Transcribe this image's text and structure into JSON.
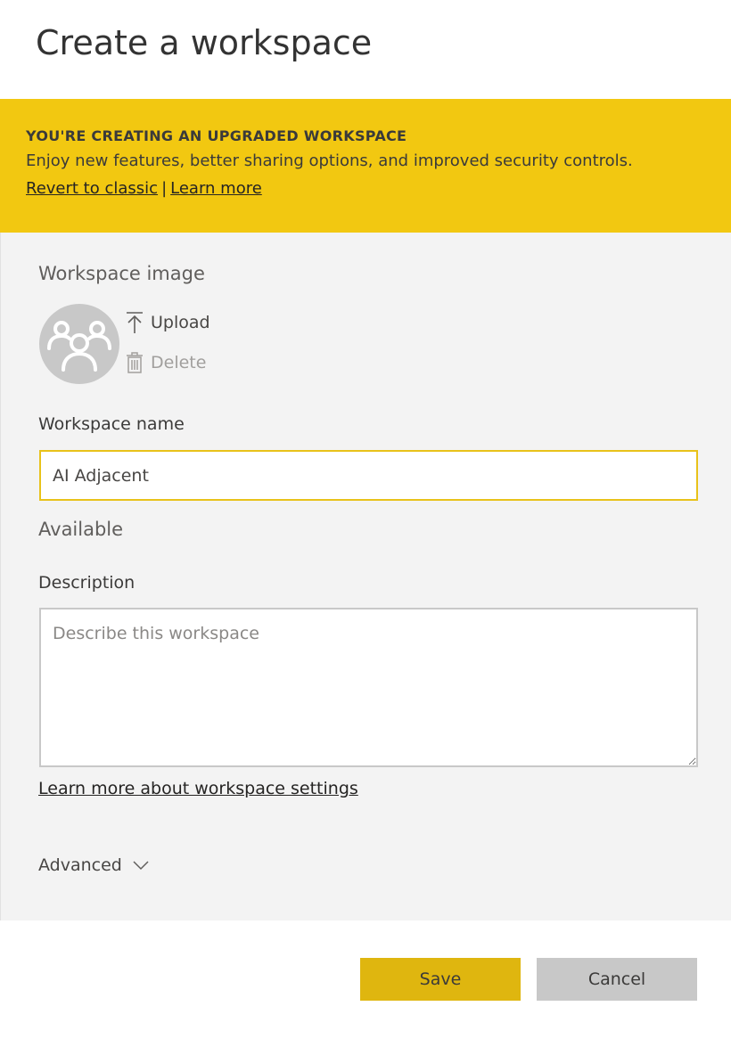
{
  "dialog": {
    "title": "Create a workspace"
  },
  "banner": {
    "heading": "YOU'RE CREATING AN UPGRADED WORKSPACE",
    "text": "Enjoy new features, better sharing options, and improved security controls.",
    "revert_link": "Revert to classic",
    "separator": "|",
    "learn_more_link": "Learn more",
    "background_color": "#f2c811"
  },
  "workspace_image": {
    "label": "Workspace image",
    "avatar_icon": "group-people-icon",
    "upload_label": "Upload",
    "upload_icon": "upload-arrow-icon",
    "delete_label": "Delete",
    "delete_icon": "trash-icon"
  },
  "workspace_name": {
    "label": "Workspace name",
    "value": "AI Adjacent",
    "status": "Available",
    "focus_border_color": "#e8c21a"
  },
  "description": {
    "label": "Description",
    "value": "",
    "placeholder": "Describe this workspace"
  },
  "settings_link": "Learn more about workspace settings",
  "advanced": {
    "label": "Advanced",
    "icon": "chevron-down-icon"
  },
  "footer": {
    "save_label": "Save",
    "cancel_label": "Cancel",
    "save_color": "#dfb60f",
    "cancel_color": "#c8c8c8"
  }
}
